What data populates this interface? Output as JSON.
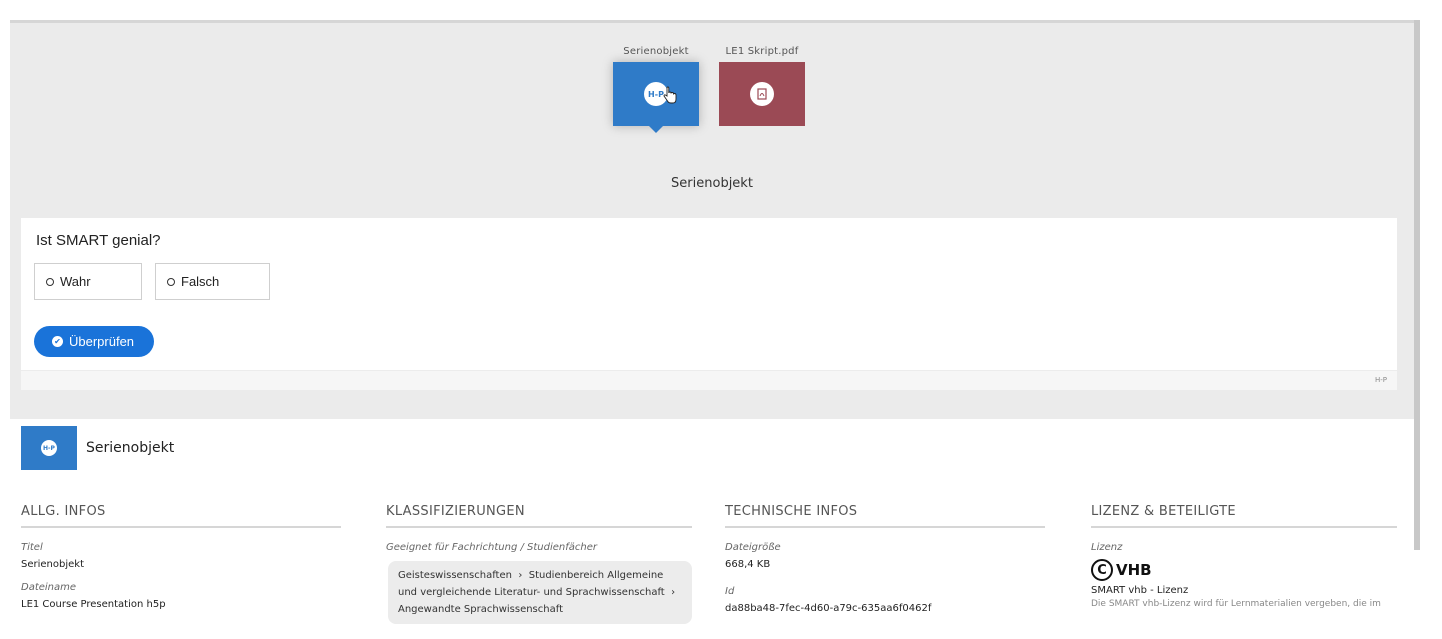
{
  "carousel": {
    "items": [
      {
        "label": "Serienobjekt",
        "badge": "H-P"
      },
      {
        "label": "LE1 Skript.pdf",
        "badge": "PDF"
      }
    ],
    "selected_title": "Serienobjekt"
  },
  "quiz": {
    "question": "Ist SMART genial?",
    "answers": [
      "Wahr",
      "Falsch"
    ],
    "check_label": "Überprüfen",
    "footer_mark": "H-P"
  },
  "detail": {
    "badge": "H-P",
    "title": "Serienobjekt"
  },
  "sections": {
    "general": {
      "heading": "ALLG. INFOS",
      "title_label": "Titel",
      "title_value": "Serienobjekt",
      "filename_label": "Dateiname",
      "filename_value": "LE1 Course Presentation h5p"
    },
    "classification": {
      "heading": "KLASSIFIZIERUNGEN",
      "suited_label": "Geeignet für Fachrichtung / Studienfächer",
      "tag_part1": "Geisteswissenschaften",
      "tag_part2": "Studienbereich Allgemeine und vergleichende Literatur- und Sprachwissenschaft",
      "tag_part3": "Angewandte Sprachwissenschaft"
    },
    "technical": {
      "heading": "TECHNISCHE INFOS",
      "size_label": "Dateigröße",
      "size_value": "668,4 KB",
      "id_label": "Id",
      "id_value": "da88ba48-7fec-4d60-a79c-635aa6f0462f"
    },
    "license": {
      "heading": "LIZENZ & BETEILIGTE",
      "license_label": "Lizenz",
      "cc_symbol": "C",
      "cc_text": "VHB",
      "license_name": "SMART vhb - Lizenz",
      "license_desc": "Die SMART vhb-Lizenz wird für Lernmaterialien vergeben, die im"
    }
  }
}
